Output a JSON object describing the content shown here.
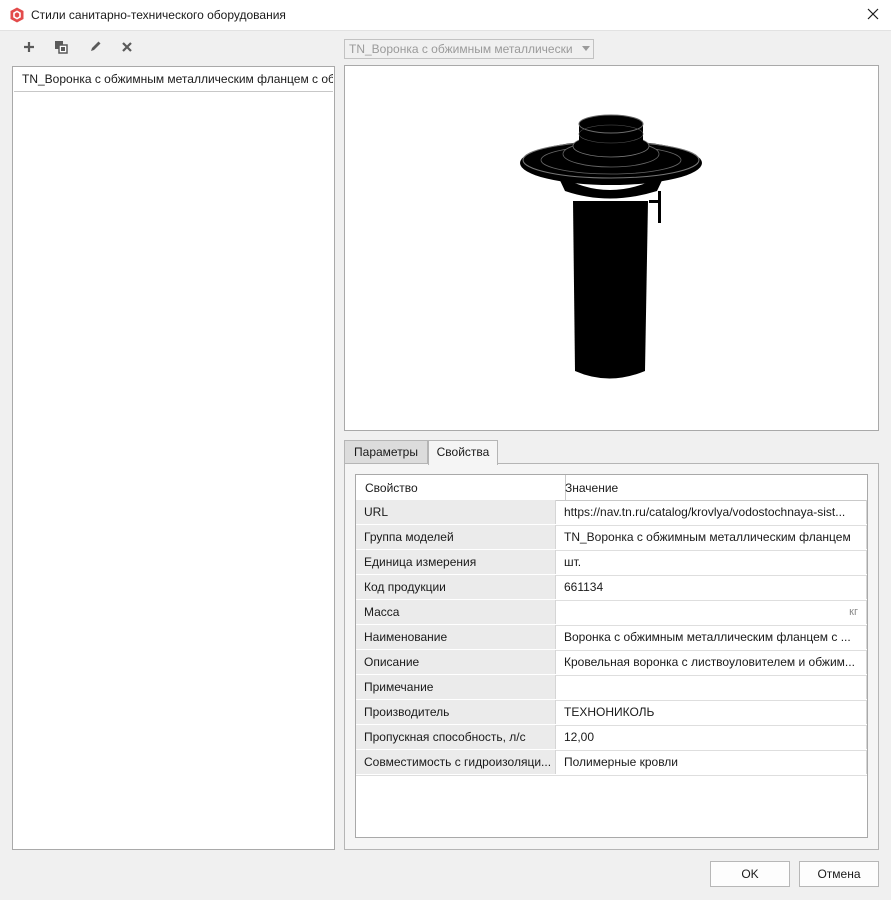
{
  "window": {
    "title": "Стили санитарно-технического оборудования",
    "icon": "shield-hexagon-icon",
    "close_icon": "close-icon"
  },
  "toolbar": {
    "add_icon": "plus-icon",
    "copy_icon": "copy-icon",
    "edit_icon": "pencil-icon",
    "delete_icon": "x-icon"
  },
  "styles_list": {
    "items": [
      {
        "label": "TN_Воронка с обжимным металлическим фланцем с об"
      }
    ]
  },
  "style_combo": {
    "value": "TN_Воронка с обжимным металлически"
  },
  "tabs": {
    "params": "Параметры",
    "props": "Свойства",
    "active": "props"
  },
  "grid": {
    "header": {
      "property": "Свойство",
      "value": "Значение"
    },
    "rows": [
      {
        "property": "URL",
        "value": "https://nav.tn.ru/catalog/krovlya/vodostochnaya-sist..."
      },
      {
        "property": "Группа моделей",
        "value": "TN_Воронка с обжимным металлическим фланцем"
      },
      {
        "property": "Единица измерения",
        "value": "шт."
      },
      {
        "property": "Код продукции",
        "value": "661134"
      },
      {
        "property": "Масса",
        "value": "",
        "unit": "кг"
      },
      {
        "property": "Наименование",
        "value": "Воронка с обжимным металлическим фланцем с ..."
      },
      {
        "property": "Описание",
        "value": "Кровельная воронка с листвоуловителем и обжим..."
      },
      {
        "property": "Примечание",
        "value": ""
      },
      {
        "property": "Производитель",
        "value": "ТЕХНОНИКОЛЬ"
      },
      {
        "property": "Пропускная способность, л/с",
        "value": "12,00"
      },
      {
        "property": "Совместимость с гидроизоляци...",
        "value": "Полимерные кровли"
      }
    ]
  },
  "buttons": {
    "ok": "OK",
    "cancel": "Отмена"
  },
  "colors": {
    "accent_icon": "#d9534f",
    "background": "#f0f0f0",
    "property_cell": "#ebebeb"
  }
}
